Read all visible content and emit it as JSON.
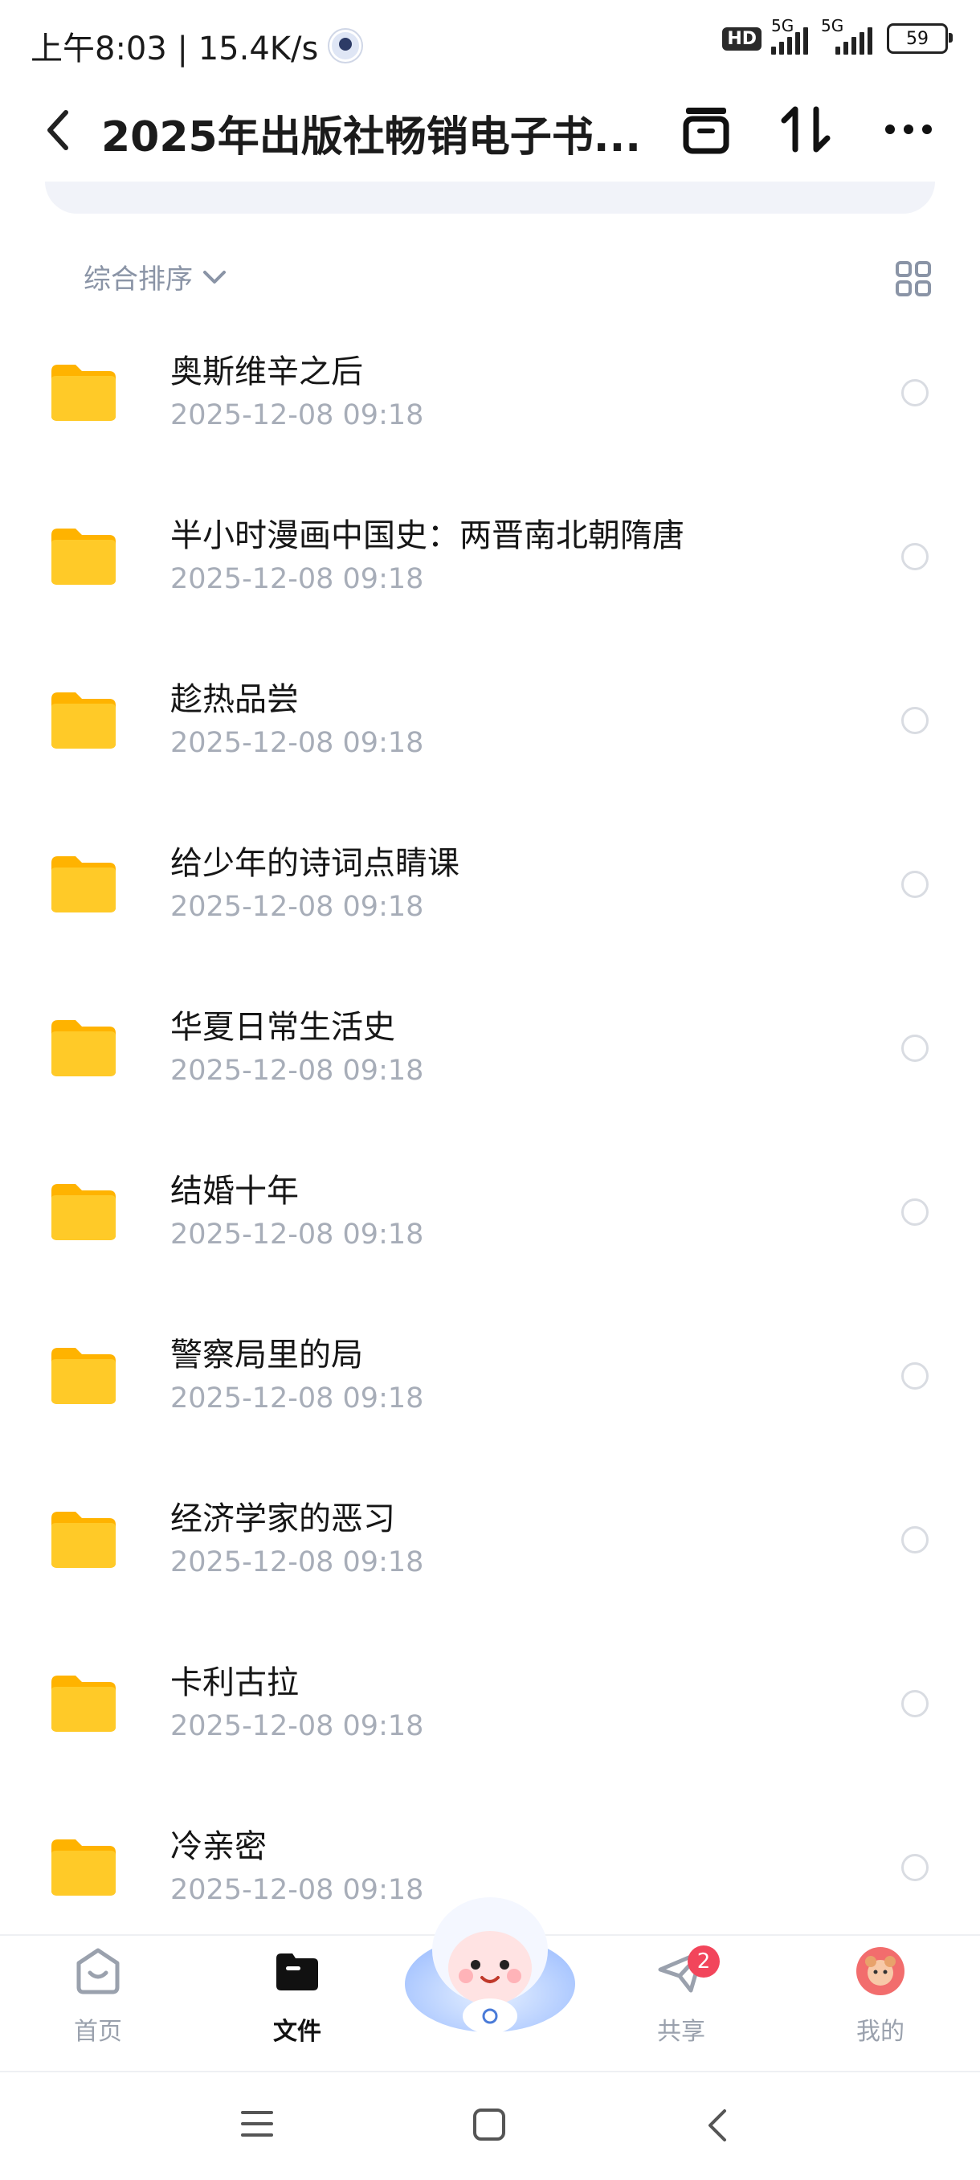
{
  "status": {
    "time_speed": "上午8:03 | 15.4K/s",
    "hd": "HD",
    "net1": "5G",
    "net2": "5G",
    "battery": "59"
  },
  "header": {
    "title": "2025年出版社畅销电子书...",
    "icons": [
      "back-icon",
      "archive-icon",
      "sort-icon",
      "more-icon"
    ]
  },
  "toolbar": {
    "sort_label": "综合排序"
  },
  "files": [
    {
      "name": "奥斯维辛之后",
      "date": "2025-12-08  09:18"
    },
    {
      "name": "半小时漫画中国史：两晋南北朝隋唐",
      "date": "2025-12-08  09:18"
    },
    {
      "name": "趁热品尝",
      "date": "2025-12-08  09:18"
    },
    {
      "name": "给少年的诗词点睛课",
      "date": "2025-12-08  09:18"
    },
    {
      "name": "华夏日常生活史",
      "date": "2025-12-08  09:18"
    },
    {
      "name": "结婚十年",
      "date": "2025-12-08  09:18"
    },
    {
      "name": "警察局里的局",
      "date": "2025-12-08  09:18"
    },
    {
      "name": "经济学家的恶习",
      "date": "2025-12-08  09:18"
    },
    {
      "name": "卡利古拉",
      "date": "2025-12-08  09:18"
    },
    {
      "name": "冷亲密",
      "date": "2025-12-08  09:18"
    }
  ],
  "tabs": {
    "home": "首页",
    "files": "文件",
    "share": "共享",
    "share_badge": "2",
    "mine": "我的"
  },
  "colors": {
    "folder": "#FFCA28",
    "badge": "#F2455B",
    "muted": "#A7ADB8"
  }
}
